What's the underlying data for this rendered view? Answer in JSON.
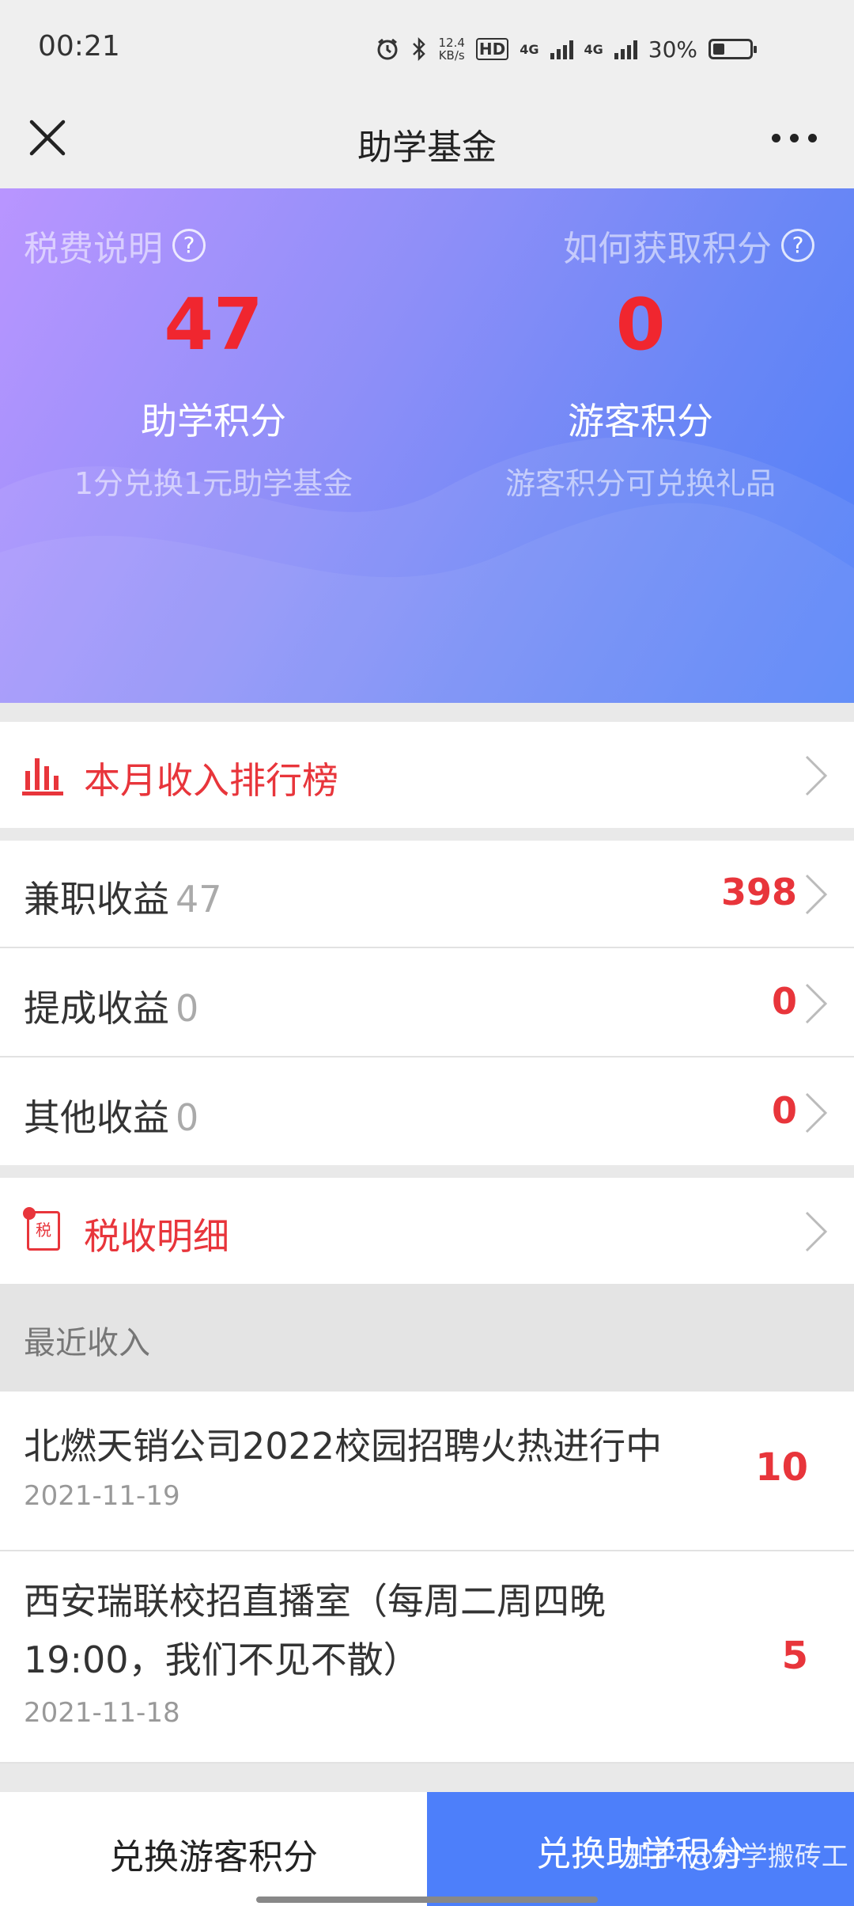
{
  "status": {
    "time": "00:21",
    "net_speed_top": "12.4",
    "net_speed_bottom": "KB/s",
    "hd": "HD",
    "sim1": "4G",
    "sim2": "4G",
    "battery": "30%"
  },
  "nav": {
    "title": "助学基金"
  },
  "hero": {
    "left": {
      "link": "税费说明",
      "value": "47",
      "label": "助学积分",
      "sub": "1分兑换1元助学基金"
    },
    "right": {
      "link": "如何获取积分",
      "value": "0",
      "label": "游客积分",
      "sub": "游客积分可兑换礼品"
    },
    "qmark": "?"
  },
  "ranking": {
    "label": "本月收入排行榜"
  },
  "earnings": [
    {
      "label": "兼职收益",
      "count": "47",
      "amount": "398"
    },
    {
      "label": "提成收益",
      "count": "0",
      "amount": "0"
    },
    {
      "label": "其他收益",
      "count": "0",
      "amount": "0"
    }
  ],
  "tax": {
    "label": "税收明细",
    "icon_char": "税"
  },
  "recent": {
    "header": "最近收入",
    "items": [
      {
        "title": "北燃天销公司2022校园招聘火热进行中",
        "date": "2021-11-19",
        "points": "10"
      },
      {
        "title": "西安瑞联校招直播室（每周二周四晚19:00，我们不见不散）",
        "date": "2021-11-18",
        "points": "5"
      }
    ]
  },
  "bottom": {
    "guest_btn": "兑换游客积分",
    "aid_btn": "兑换助学积分",
    "watermark": "知乎 @科学搬砖工"
  },
  "colors": {
    "accent_red": "#e8353b",
    "value_red": "#f0262f",
    "primary_blue": "#4d7ffa"
  }
}
